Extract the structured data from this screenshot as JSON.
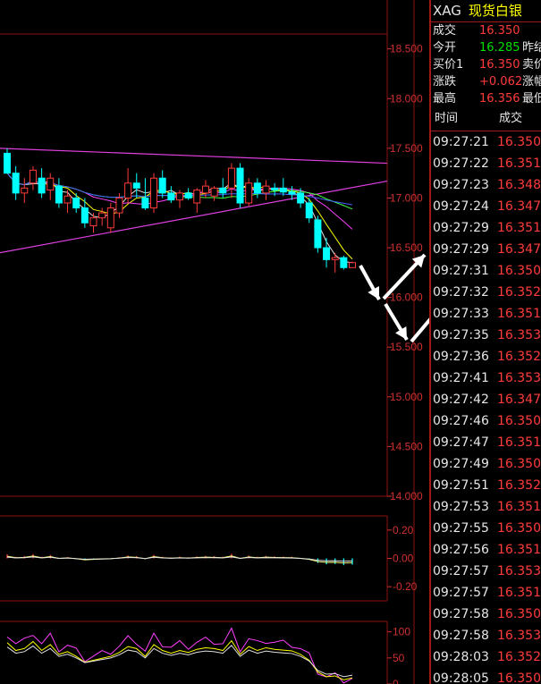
{
  "header": {
    "symbol": "XAG",
    "name": "现货白银"
  },
  "quote": [
    {
      "label": "成交",
      "value": "16.350",
      "color": "#ff3b3b",
      "extra": ""
    },
    {
      "label": "今开",
      "value": "16.285",
      "color": "#00e000",
      "extra": "昨结"
    },
    {
      "label": "买价1",
      "value": "16.350",
      "color": "#ff3b3b",
      "extra": "卖价"
    },
    {
      "label": "涨跌",
      "value": "+0.062",
      "color": "#ff3b3b",
      "extra": "涨幅"
    },
    {
      "label": "最高",
      "value": "16.356",
      "color": "#ff3b3b",
      "extra": "最低"
    }
  ],
  "ticks_header": {
    "time": "时间",
    "price": "成交"
  },
  "ticks": [
    {
      "time": "09:27:21",
      "price": "16.350"
    },
    {
      "time": "09:27:22",
      "price": "16.351"
    },
    {
      "time": "09:27:23",
      "price": "16.348"
    },
    {
      "time": "09:27:24",
      "price": "16.347"
    },
    {
      "time": "09:27:29",
      "price": "16.351"
    },
    {
      "time": "09:27:29",
      "price": "16.347"
    },
    {
      "time": "09:27:31",
      "price": "16.350"
    },
    {
      "time": "09:27:32",
      "price": "16.352"
    },
    {
      "time": "09:27:33",
      "price": "16.351"
    },
    {
      "time": "09:27:35",
      "price": "16.353"
    },
    {
      "time": "09:27:36",
      "price": "16.352"
    },
    {
      "time": "09:27:41",
      "price": "16.353"
    },
    {
      "time": "09:27:42",
      "price": "16.347"
    },
    {
      "time": "09:27:46",
      "price": "16.350"
    },
    {
      "time": "09:27:47",
      "price": "16.351"
    },
    {
      "time": "09:27:49",
      "price": "16.350"
    },
    {
      "time": "09:27:51",
      "price": "16.352"
    },
    {
      "time": "09:27:53",
      "price": "16.351"
    },
    {
      "time": "09:27:55",
      "price": "16.350"
    },
    {
      "time": "09:27:56",
      "price": "16.351"
    },
    {
      "time": "09:27:57",
      "price": "16.353"
    },
    {
      "time": "09:27:57",
      "price": "16.351"
    },
    {
      "time": "09:27:58",
      "price": "16.350"
    },
    {
      "time": "09:27:58",
      "price": "16.353"
    },
    {
      "time": "09:28:03",
      "price": "16.352"
    },
    {
      "time": "09:28:05",
      "price": "16.350"
    }
  ],
  "colors": {
    "up": "#ff3b3b",
    "down": "#00ffff",
    "grid": "#8b1010",
    "axis_text": "#d03030"
  },
  "chart_data": [
    {
      "type": "candlestick",
      "ylim": [
        14.0,
        18.65
      ],
      "yticks": [
        "18.500",
        "18.000",
        "17.500",
        "17.000",
        "16.500",
        "16.000",
        "15.500",
        "15.000",
        "14.500",
        "14.000"
      ],
      "candles": [
        {
          "o": 17.45,
          "h": 17.5,
          "l": 17.25,
          "c": 17.25
        },
        {
          "o": 17.25,
          "h": 17.32,
          "l": 16.98,
          "c": 17.05
        },
        {
          "o": 17.05,
          "h": 17.2,
          "l": 16.95,
          "c": 17.1
        },
        {
          "o": 17.15,
          "h": 17.32,
          "l": 17.08,
          "c": 17.28
        },
        {
          "o": 17.2,
          "h": 17.3,
          "l": 17.0,
          "c": 17.05
        },
        {
          "o": 17.08,
          "h": 17.25,
          "l": 16.98,
          "c": 17.2
        },
        {
          "o": 17.12,
          "h": 17.2,
          "l": 16.9,
          "c": 16.95
        },
        {
          "o": 16.95,
          "h": 17.08,
          "l": 16.85,
          "c": 17.02
        },
        {
          "o": 17.0,
          "h": 17.05,
          "l": 16.85,
          "c": 16.9
        },
        {
          "o": 16.9,
          "h": 17.0,
          "l": 16.7,
          "c": 16.75
        },
        {
          "o": 16.72,
          "h": 16.85,
          "l": 16.65,
          "c": 16.8
        },
        {
          "o": 16.8,
          "h": 16.9,
          "l": 16.72,
          "c": 16.85
        },
        {
          "o": 16.7,
          "h": 16.95,
          "l": 16.65,
          "c": 16.9
        },
        {
          "o": 16.85,
          "h": 17.05,
          "l": 16.8,
          "c": 17.0
        },
        {
          "o": 17.0,
          "h": 17.3,
          "l": 16.95,
          "c": 17.15
        },
        {
          "o": 17.15,
          "h": 17.25,
          "l": 17.0,
          "c": 17.1
        },
        {
          "o": 17.0,
          "h": 17.2,
          "l": 16.88,
          "c": 16.9
        },
        {
          "o": 16.9,
          "h": 17.25,
          "l": 16.85,
          "c": 17.2
        },
        {
          "o": 17.2,
          "h": 17.28,
          "l": 17.0,
          "c": 17.05
        },
        {
          "o": 17.05,
          "h": 17.12,
          "l": 16.95,
          "c": 16.98
        },
        {
          "o": 16.98,
          "h": 17.08,
          "l": 16.9,
          "c": 17.05
        },
        {
          "o": 17.05,
          "h": 17.1,
          "l": 16.98,
          "c": 17.0
        },
        {
          "o": 16.95,
          "h": 17.1,
          "l": 16.85,
          "c": 17.08
        },
        {
          "o": 17.05,
          "h": 17.18,
          "l": 17.0,
          "c": 17.12
        },
        {
          "o": 17.02,
          "h": 17.12,
          "l": 16.97,
          "c": 17.1
        },
        {
          "o": 17.1,
          "h": 17.2,
          "l": 17.0,
          "c": 17.05
        },
        {
          "o": 17.1,
          "h": 17.35,
          "l": 17.0,
          "c": 17.3
        },
        {
          "o": 17.3,
          "h": 17.35,
          "l": 16.9,
          "c": 16.95
        },
        {
          "o": 16.95,
          "h": 17.2,
          "l": 16.92,
          "c": 17.15
        },
        {
          "o": 17.15,
          "h": 17.2,
          "l": 17.0,
          "c": 17.05
        },
        {
          "o": 17.05,
          "h": 17.18,
          "l": 16.98,
          "c": 17.12
        },
        {
          "o": 17.1,
          "h": 17.15,
          "l": 17.02,
          "c": 17.08
        },
        {
          "o": 17.1,
          "h": 17.2,
          "l": 17.02,
          "c": 17.06
        },
        {
          "o": 17.06,
          "h": 17.12,
          "l": 16.98,
          "c": 17.04
        },
        {
          "o": 17.05,
          "h": 17.1,
          "l": 16.9,
          "c": 16.95
        },
        {
          "o": 16.95,
          "h": 17.0,
          "l": 16.75,
          "c": 16.8
        },
        {
          "o": 16.78,
          "h": 16.82,
          "l": 16.45,
          "c": 16.5
        },
        {
          "o": 16.5,
          "h": 16.6,
          "l": 16.3,
          "c": 16.38
        },
        {
          "o": 16.38,
          "h": 16.45,
          "l": 16.25,
          "c": 16.4
        },
        {
          "o": 16.4,
          "h": 16.42,
          "l": 16.28,
          "c": 16.3
        },
        {
          "o": 16.3,
          "h": 16.36,
          "l": 16.3,
          "c": 16.35
        }
      ]
    },
    {
      "type": "bar",
      "ylim": [
        -0.3,
        0.3
      ],
      "yticks": [
        "0.20",
        "0.00",
        "-0.20"
      ]
    },
    {
      "type": "line",
      "ylim": [
        0,
        120
      ],
      "yticks": [
        "100",
        "50",
        "0"
      ]
    }
  ]
}
